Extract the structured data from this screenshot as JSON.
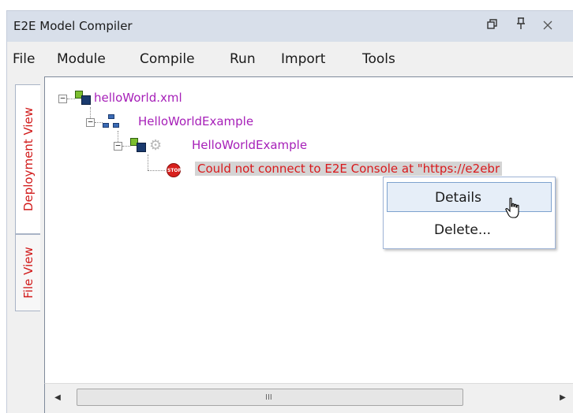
{
  "window": {
    "title": "E2E Model Compiler",
    "buttons": {
      "restore": "restore-icon",
      "pin": "pin-icon",
      "close": "close-icon"
    }
  },
  "menu": [
    "File",
    "Module",
    "Compile",
    "Run",
    "Import",
    "Tools"
  ],
  "side_tabs": {
    "deployment": "Deployment View",
    "file": "File View"
  },
  "tree": {
    "root": "helloWorld.xml",
    "child": "HelloWorldExample",
    "grandchild": "HelloWorldExample",
    "error": "Could not connect to E2E Console at \"https://e2ebr",
    "stop_icon_text": "STOP"
  },
  "context_menu": {
    "details": "Details",
    "delete": "Delete..."
  },
  "scrollbar": {
    "grip": "III"
  },
  "colors": {
    "node_text": "#a61fb8",
    "error_text": "#d9191c",
    "tab_text": "#d11a1a",
    "titlebar": "#d8dfea"
  }
}
